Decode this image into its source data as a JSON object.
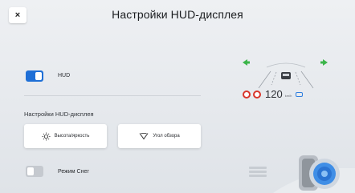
{
  "header": {
    "close_glyph": "×",
    "title": "Настройки HUD-дисплея"
  },
  "hud": {
    "label": "HUD",
    "enabled": true
  },
  "settings": {
    "section_label": "Настройки HUD-дисплея",
    "brightness_label": "Высота/яркость",
    "angle_label": "Угол обзора"
  },
  "snow_mode": {
    "label": "Режим Снег",
    "enabled": false
  },
  "preview": {
    "speed": "120",
    "unit": "km/h",
    "colors": {
      "arrow": "#3cb54a",
      "warning_sign": "#d9362c",
      "accent": "#1f6fd6"
    }
  }
}
